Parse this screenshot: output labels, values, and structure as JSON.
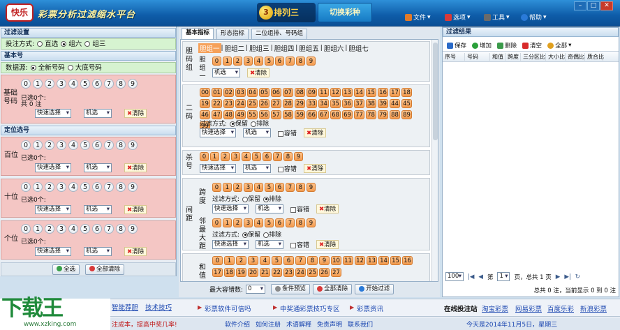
{
  "app": {
    "logo_text": "快乐",
    "title": "彩票分析过滤缩水平台",
    "lottery_ball": "3",
    "lottery_name": "排列三",
    "switch_label": "切换彩种"
  },
  "menu": [
    {
      "label": "文件",
      "color": "#e07a2a"
    },
    {
      "label": "选项",
      "color": "#d83a3a"
    },
    {
      "label": "工具",
      "color": "#6a6a6a"
    },
    {
      "label": "帮助",
      "color": "#2a7ad8"
    }
  ],
  "left": {
    "filter_settings": "过滤设置",
    "bet_mode_label": "投注方式:",
    "bet_modes": [
      {
        "label": "直选",
        "checked": false
      },
      {
        "label": "组六",
        "checked": true
      },
      {
        "label": "组三",
        "checked": false
      }
    ],
    "basic_title": "基本号",
    "source_label": "数据源:",
    "sources": [
      {
        "label": "全新号码",
        "checked": true
      },
      {
        "label": "大底号码",
        "checked": false
      }
    ],
    "basic_label": "基础号码",
    "digits": [
      "0",
      "1",
      "2",
      "3",
      "4",
      "5",
      "6",
      "7",
      "8",
      "9"
    ],
    "selected_count": "已选0个:",
    "total": "共 0 注",
    "quick_select": "快速选择",
    "machine": "机选",
    "clear": "清除",
    "position_title": "定位选号",
    "positions": [
      {
        "label": "百位",
        "selected": "已选0个:"
      },
      {
        "label": "十位",
        "selected": "已选0个:"
      },
      {
        "label": "个位",
        "selected": "已选0个:"
      }
    ],
    "select_all": "全选",
    "clear_all": "全部清除"
  },
  "middle": {
    "tabs": [
      "基本指标",
      "形态指标",
      "二位组排、号码组"
    ],
    "dan_tabs": [
      "胆组一",
      "胆组二",
      "胆组三",
      "胆组四",
      "胆组五",
      "胆组六",
      "胆组七"
    ],
    "dan_label": "胆码组",
    "dan_one": "胆组一",
    "erma_label": "二码",
    "erma_numbers": [
      "00",
      "01",
      "02",
      "03",
      "04",
      "05",
      "06",
      "07",
      "08",
      "09",
      "11",
      "12",
      "13",
      "14",
      "15",
      "16",
      "17",
      "18",
      "19",
      "22",
      "23",
      "24",
      "25",
      "26",
      "27",
      "28",
      "29",
      "33",
      "34",
      "35",
      "36",
      "37",
      "38",
      "39",
      "44",
      "45",
      "46",
      "47",
      "48",
      "49",
      "55",
      "56",
      "57",
      "58",
      "59",
      "66",
      "67",
      "68",
      "69",
      "77",
      "78",
      "79",
      "88",
      "89",
      "99"
    ],
    "filter_mode": "过滤方式:",
    "keep": "保留",
    "exclude": "排除",
    "tolerance": "容错",
    "kill_label": "杀号",
    "span_label": "跨度",
    "spacing_label": "间距",
    "neighbor_label": "邻最大距",
    "sum_label": "和值",
    "sum_numbers": [
      "0",
      "1",
      "2",
      "3",
      "4",
      "5",
      "6",
      "7",
      "8",
      "9",
      "10",
      "11",
      "12",
      "13",
      "14",
      "15",
      "16",
      "17",
      "18",
      "19",
      "20",
      "21",
      "22",
      "23",
      "24",
      "25",
      "26",
      "27"
    ],
    "max_tolerance": "最大容错数:",
    "max_tolerance_value": "0",
    "condition_preview": "条件预览",
    "clear_all": "全部清除",
    "start_filter": "开始过滤"
  },
  "right": {
    "title": "过滤结果",
    "toolbar": [
      "保存",
      "增加",
      "删除",
      "清空",
      "全部"
    ],
    "columns": [
      "序号",
      "号码",
      "和值",
      "跨度",
      "三分区比",
      "大小比",
      "奇偶比",
      "质合比"
    ],
    "page_size": "100",
    "page_prefix": "第",
    "page_value": "1",
    "page_suffix": "页，总共 1 页",
    "summary": "总共 0 注，当前显示 0 到 0 注"
  },
  "footer": {
    "watermark_main": "下载王",
    "watermark_url": "www.xzking.com",
    "links1": [
      "智能荐胆",
      "技术技巧"
    ],
    "news": [
      "彩票软件可信吗",
      "中奖通彩票技巧专区",
      "彩票资讯"
    ],
    "site_label": "在线投注站",
    "sites": [
      "淘宝彩票",
      "网易彩票",
      "百度乐彩",
      "新浪彩票"
    ],
    "marquee": "注成本，提高中奖几率!",
    "status_links": [
      "软件介绍",
      "如何注册",
      "术语解释",
      "免责声明",
      "联系我们"
    ],
    "date": "今天是2014年11月5日，星期三"
  }
}
